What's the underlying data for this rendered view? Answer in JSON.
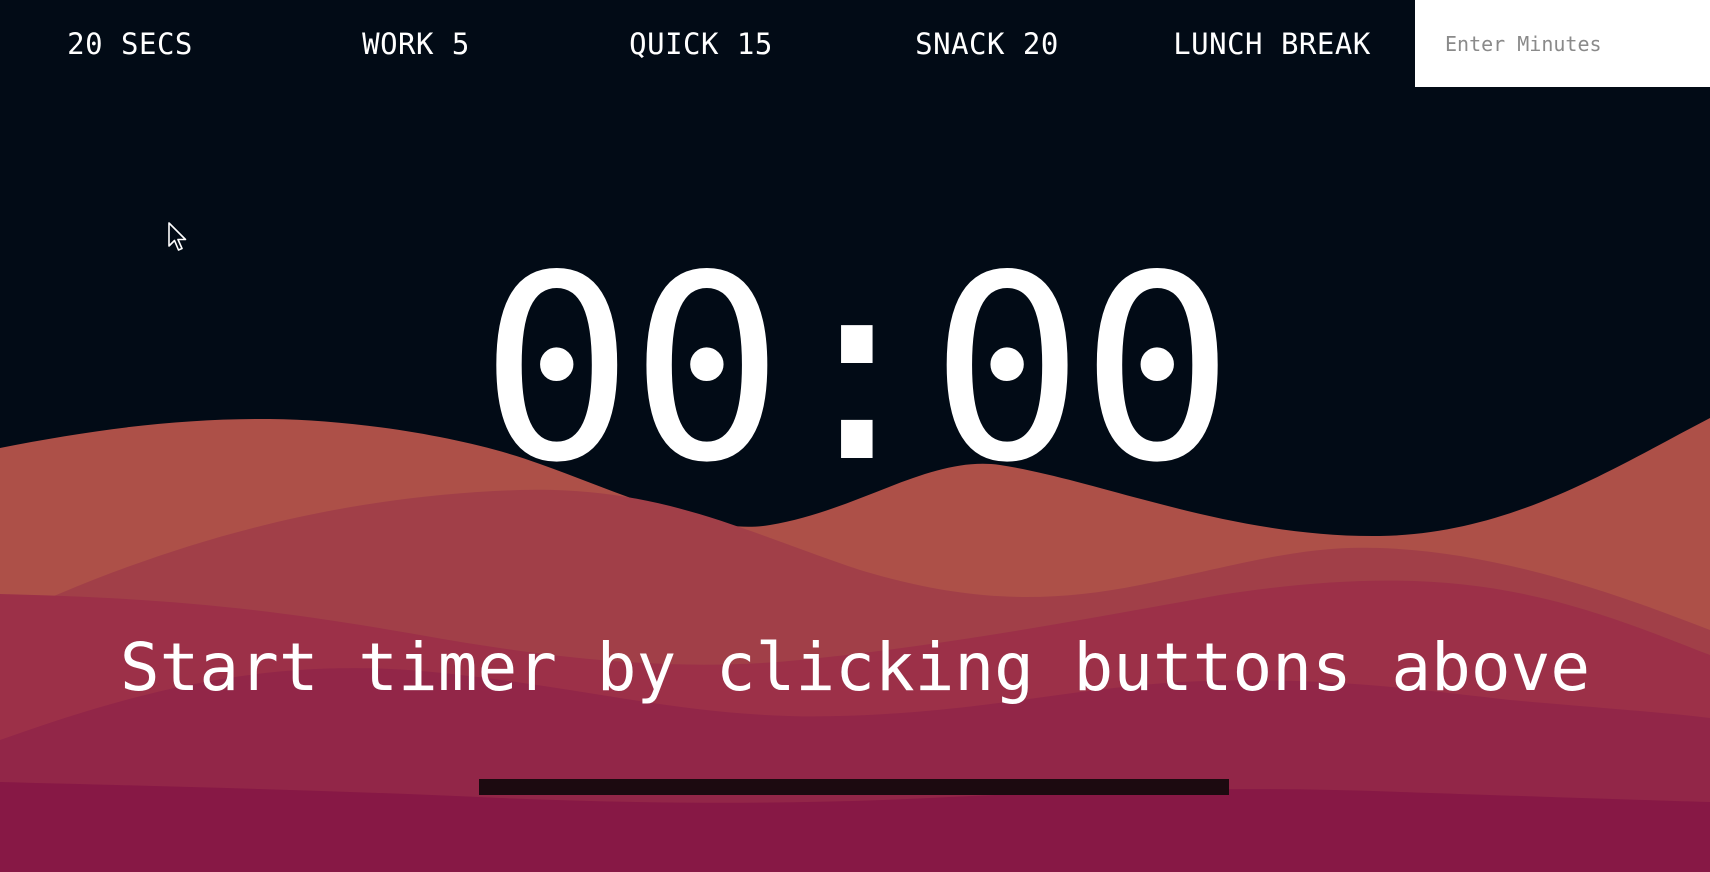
{
  "presets": [
    {
      "label": "20 SECS"
    },
    {
      "label": "WORK 5"
    },
    {
      "label": "QUICK 15"
    },
    {
      "label": "SNACK 20"
    },
    {
      "label": "LUNCH BREAK"
    }
  ],
  "custom_minutes": {
    "value": "",
    "placeholder": "Enter Minutes"
  },
  "timer": {
    "display": "00:00"
  },
  "message": "Start timer by clicking buttons above",
  "progress": {
    "fraction": 0
  },
  "colors": {
    "background": "#020b16",
    "hill_1": "#ad5048",
    "hill_2": "#a13f48",
    "hill_3": "#9c3048",
    "hill_4": "#922648",
    "hill_5": "#871845",
    "progress_track": "#1c0a10"
  },
  "icons": {
    "cursor": "mouse-pointer-icon"
  }
}
